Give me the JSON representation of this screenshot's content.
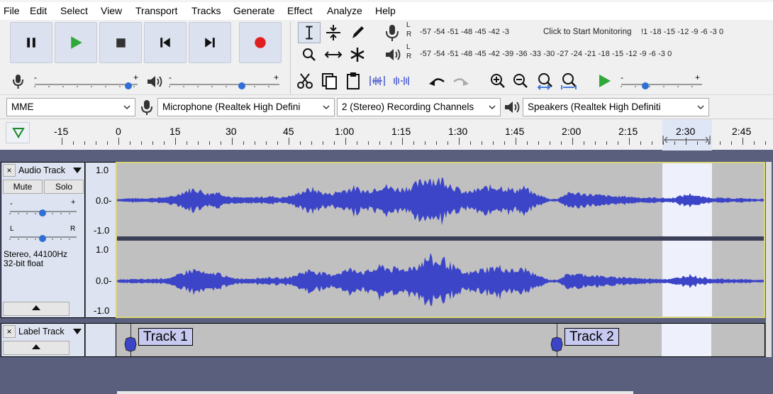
{
  "menu": [
    "File",
    "Edit",
    "Select",
    "View",
    "Transport",
    "Tracks",
    "Generate",
    "Effect",
    "Analyze",
    "Help"
  ],
  "meters": {
    "record_scale": "-57 -54 -51 -48 -45 -42 -3",
    "record_prompt": "Click to Start Monitoring",
    "record_scale_tail": "!1 -18 -15 -12  -9   -6   -3   0",
    "play_scale": "-57 -54 -51 -48 -45 -42 -39 -36 -33 -30 -27 -24 -21 -18 -15 -12  -9   -6   -3   0",
    "channel_l": "L",
    "channel_r": "R"
  },
  "devices": {
    "host": "MME",
    "input": "Microphone (Realtek High Defini",
    "channels": "2 (Stereo) Recording Channels",
    "output": "Speakers (Realtek High Definiti"
  },
  "timeline": {
    "labels": [
      "-15",
      "0",
      "15",
      "30",
      "45",
      "1:00",
      "1:15",
      "1:30",
      "1:45",
      "2:00",
      "2:15",
      "2:30",
      "2:45"
    ]
  },
  "audio_track": {
    "close": "×",
    "name": "Audio Track",
    "mute": "Mute",
    "solo": "Solo",
    "gain_minus": "-",
    "gain_plus": "+",
    "pan_left": "L",
    "pan_right": "R",
    "info_line1": "Stereo, 44100Hz",
    "info_line2": "32-bit float",
    "scale_top": "1.0",
    "scale_mid": "0.0-",
    "scale_bottom": "-1.0",
    "scale2_top": "1.0",
    "scale2_mid": "0.0-",
    "scale2_bottom": "-1.0"
  },
  "label_track": {
    "close": "×",
    "name": "Label Track",
    "labels": [
      "Track 1",
      "Track 2"
    ]
  },
  "colors": {
    "waveform": "#3c45c8",
    "track_bg": "#c0c0c0",
    "selection": "#eef1fb",
    "record": "#e02020",
    "play": "#2fa83a"
  }
}
